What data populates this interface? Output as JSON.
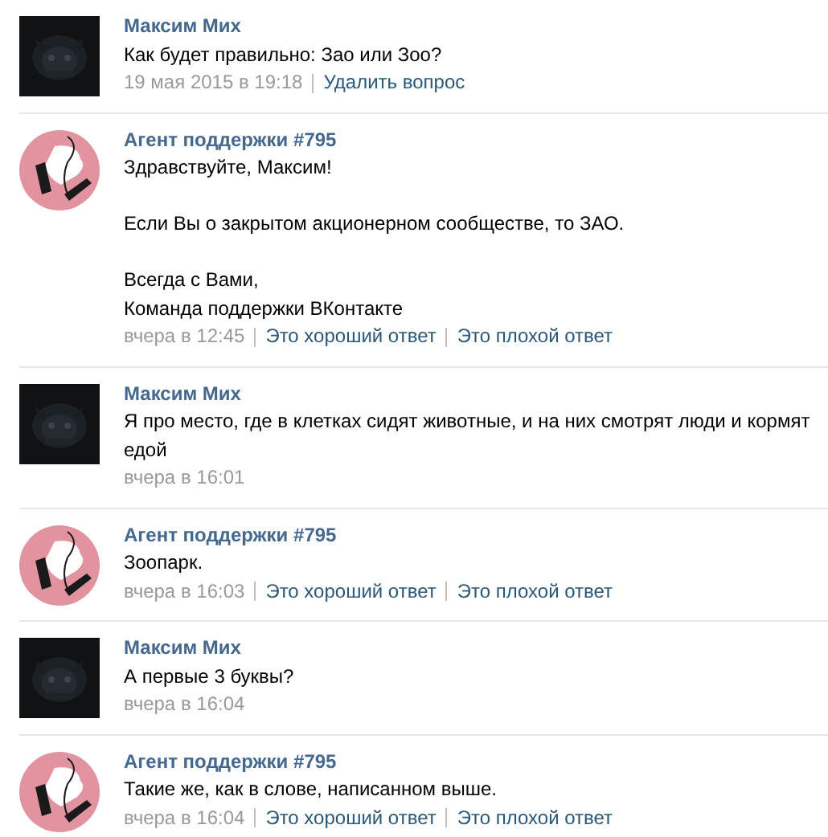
{
  "messages": [
    {
      "kind": "user",
      "author": "Максим Мих",
      "paragraphs": [
        [
          "Как будет правильно: Зао или Зоо?"
        ]
      ],
      "date": "19 мая 2015 в 19:18",
      "actions": [
        "Удалить вопрос"
      ]
    },
    {
      "kind": "agent",
      "author": "Агент поддержки #795",
      "paragraphs": [
        [
          "Здравствуйте, Максим!"
        ],
        [
          "Если Вы о закрытом акционерном сообществе, то ЗАО."
        ],
        [
          "Всегда с Вами,",
          "Команда поддержки ВКонтакте"
        ]
      ],
      "date": "вчера в 12:45",
      "actions": [
        "Это хороший ответ",
        "Это плохой ответ"
      ]
    },
    {
      "kind": "user",
      "author": "Максим Мих",
      "paragraphs": [
        [
          "Я про место, где в клетках сидят животные, и на них смотрят люди и кормят едой"
        ]
      ],
      "date": "вчера в 16:01"
    },
    {
      "kind": "agent",
      "author": "Агент поддержки #795",
      "paragraphs": [
        [
          "Зоопарк."
        ]
      ],
      "date": "вчера в 16:03",
      "actions": [
        "Это хороший ответ",
        "Это плохой ответ"
      ]
    },
    {
      "kind": "user",
      "author": "Максим Мих",
      "paragraphs": [
        [
          "А первые 3 буквы?"
        ]
      ],
      "date": "вчера в 16:04"
    },
    {
      "kind": "agent",
      "author": "Агент поддержки #795",
      "paragraphs": [
        [
          "Такие же, как в слове, написанном выше."
        ]
      ],
      "date": "вчера в 16:04",
      "actions": [
        "Это хороший ответ",
        "Это плохой ответ"
      ]
    }
  ]
}
